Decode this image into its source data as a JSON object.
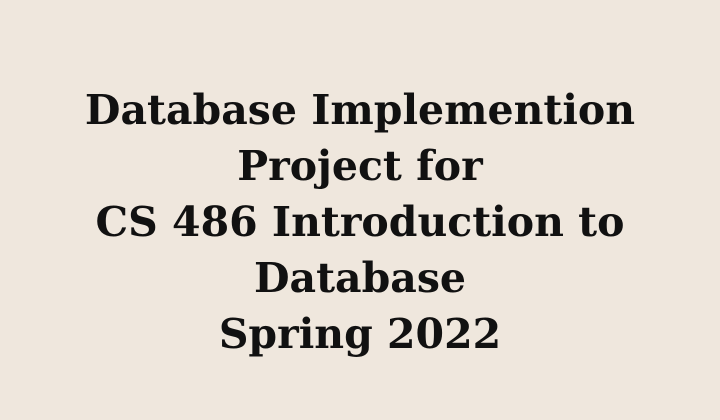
{
  "document": {
    "title_lines": [
      "Database Implemention",
      "Project for",
      "CS 486 Introduction to",
      "Database",
      "Spring 2022"
    ]
  },
  "colors": {
    "background": "#efe7dd",
    "text": "#111111"
  }
}
